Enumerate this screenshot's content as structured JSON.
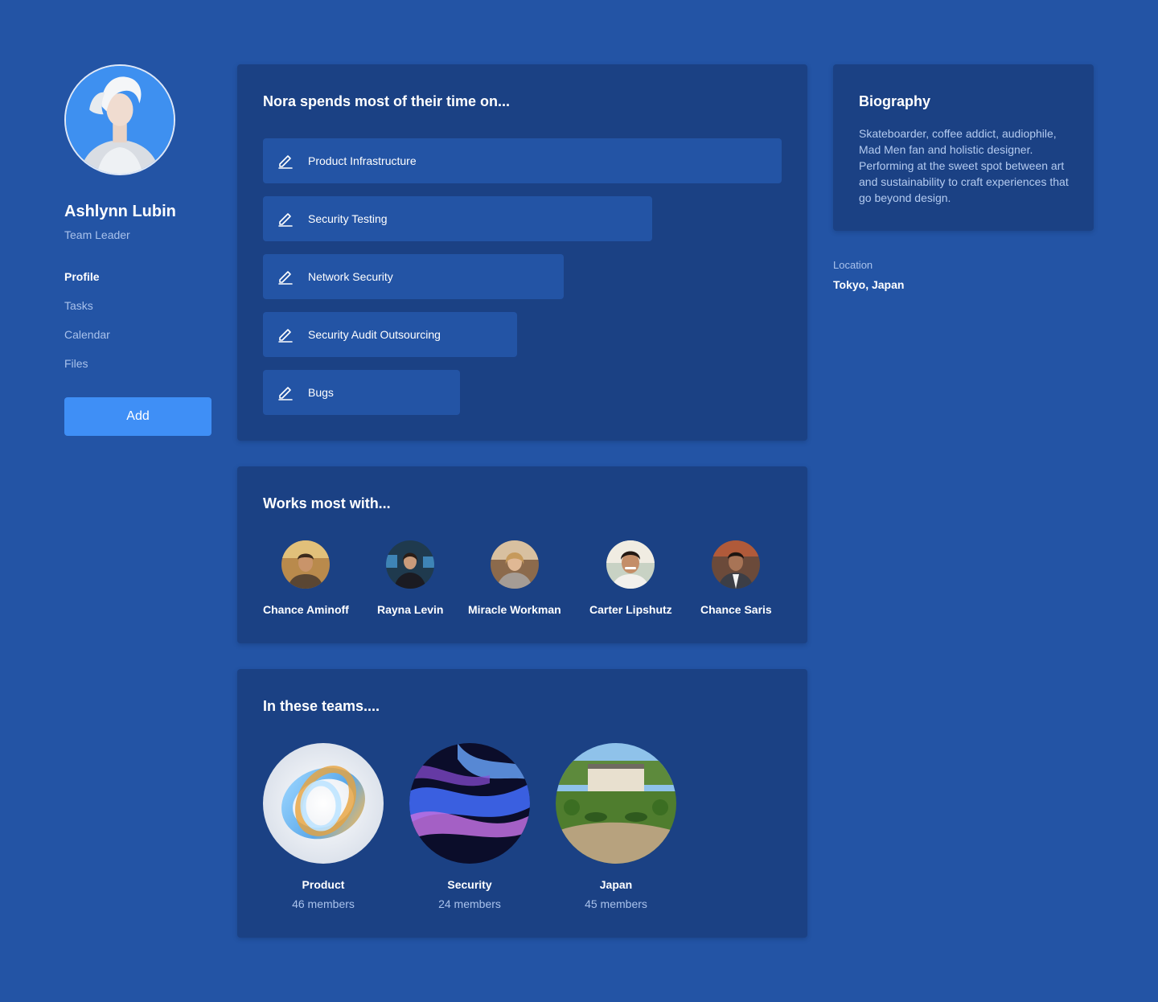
{
  "profile": {
    "name": "Ashlynn Lubin",
    "role": "Team Leader",
    "avatar": "profile-photo"
  },
  "nav": {
    "items": [
      {
        "label": "Profile",
        "active": true
      },
      {
        "label": "Tasks",
        "active": false
      },
      {
        "label": "Calendar",
        "active": false
      },
      {
        "label": "Files",
        "active": false
      }
    ],
    "add_label": "Add"
  },
  "time": {
    "title": "Nora spends most of their time on...",
    "icon": "pen-icon",
    "items": [
      {
        "label": "Product Infrastructure",
        "share": 1.0
      },
      {
        "label": "Security Testing",
        "share": 0.75
      },
      {
        "label": "Network Security",
        "share": 0.58
      },
      {
        "label": "Security Audit Outsourcing",
        "share": 0.49
      },
      {
        "label": "Bugs",
        "share": 0.38
      }
    ]
  },
  "works": {
    "title": "Works most with...",
    "people": [
      {
        "name": "Chance Aminoff"
      },
      {
        "name": "Rayna Levin"
      },
      {
        "name": "Miracle Workman"
      },
      {
        "name": "Carter Lipshutz"
      },
      {
        "name": "Chance Saris"
      }
    ]
  },
  "teams": {
    "title": "In these teams....",
    "items": [
      {
        "name": "Product",
        "members": "46 members"
      },
      {
        "name": "Security",
        "members": "24 members"
      },
      {
        "name": "Japan",
        "members": "45 members"
      }
    ]
  },
  "bio": {
    "title": "Biography",
    "text": "Skateboarder, coffee addict, audiophile, Mad Men fan and holistic designer. Performing at the sweet spot between art and sustainability to craft experiences that go beyond design."
  },
  "location": {
    "label": "Location",
    "value": "Tokyo, Japan"
  },
  "colors": {
    "background": "#2354a5",
    "card": "#1b4184",
    "accent": "#3f8ff6",
    "muted_text": "#a9c2ec"
  }
}
